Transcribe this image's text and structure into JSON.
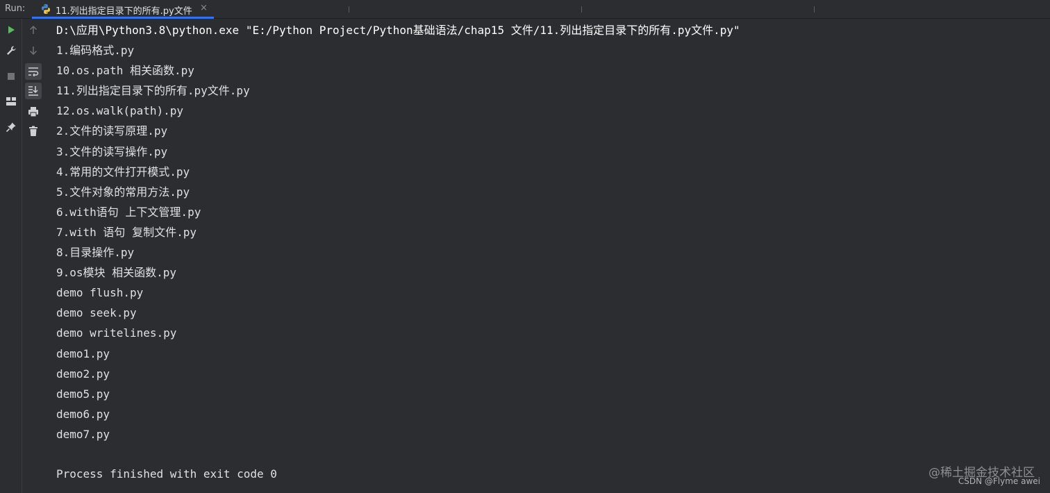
{
  "run_bar": {
    "label": "Run:",
    "tab_title": "11.列出指定目录下的所有.py文件",
    "close_glyph": "×",
    "accent_color": "#3574f0"
  },
  "toolbar_left": {
    "items": [
      {
        "name": "rerun-icon",
        "color": "#5fb865"
      },
      {
        "name": "wrench-icon"
      },
      {
        "name": "stop-icon"
      },
      {
        "name": "layout-icon"
      },
      {
        "name": "pin-icon"
      }
    ]
  },
  "toolbar_right": {
    "items": [
      {
        "name": "arrow-up-icon"
      },
      {
        "name": "arrow-down-icon"
      },
      {
        "name": "soft-wrap-icon"
      },
      {
        "name": "scroll-to-end-icon"
      },
      {
        "name": "print-icon"
      },
      {
        "name": "trash-icon"
      }
    ]
  },
  "console": {
    "command": "D:\\应用\\Python3.8\\python.exe \"E:/Python Project/Python基础语法/chap15 文件/11.列出指定目录下的所有.py文件.py\"",
    "lines": [
      "1.编码格式.py",
      "10.os.path 相关函数.py",
      "11.列出指定目录下的所有.py文件.py",
      "12.os.walk(path).py",
      "2.文件的读写原理.py",
      "3.文件的读写操作.py",
      "4.常用的文件打开模式.py",
      "5.文件对象的常用方法.py",
      "6.with语句 上下文管理.py",
      "7.with 语句 复制文件.py",
      "8.目录操作.py",
      "9.os模块 相关函数.py",
      "demo flush.py",
      "demo seek.py",
      "demo writelines.py",
      "demo1.py",
      "demo2.py",
      "demo5.py",
      "demo6.py",
      "demo7.py"
    ],
    "exit_message": "Process finished with exit code 0"
  },
  "watermark": {
    "line1": "@稀土掘金技术社区",
    "line2": "CSDN @Flyme awei"
  }
}
